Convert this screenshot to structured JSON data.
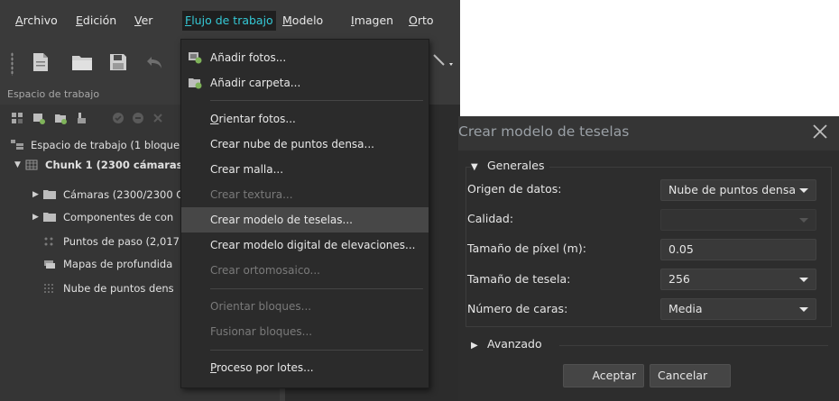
{
  "menubar": {
    "items": [
      {
        "label": "Archivo"
      },
      {
        "label": "Edición"
      },
      {
        "label": "Ver"
      },
      {
        "label": "Flujo de trabajo",
        "active": true
      },
      {
        "label": "Modelo"
      },
      {
        "label": "Imagen"
      },
      {
        "label": "Orto"
      }
    ]
  },
  "toolbar": {
    "icons": [
      "new-document-icon",
      "open-folder-icon",
      "save-icon",
      "undo-icon",
      "select-tool-icon"
    ]
  },
  "workspace": {
    "panel_title": "Espacio de trabajo",
    "toolbar_icons": [
      "add-chunk-icon",
      "add-photos-icon",
      "add-folder-icon",
      "add-marker-icon",
      "enable-icon",
      "disable-icon",
      "remove-icon"
    ],
    "tree": [
      {
        "label": "Espacio de trabajo (1 bloque,",
        "icon": "workspace-icon"
      },
      {
        "label": "Chunk 1 (2300 cámaras,",
        "icon": "chunk-icon",
        "bold": true
      },
      {
        "label": "Cámaras (2300/2300 C",
        "icon": "folder-icon"
      },
      {
        "label": "Componentes de con",
        "icon": "folder-icon"
      },
      {
        "label": "Puntos de paso (2,017",
        "icon": "tie-points-icon"
      },
      {
        "label": "Mapas de profundida",
        "icon": "depth-maps-icon"
      },
      {
        "label": "Nube de puntos dens",
        "icon": "dense-cloud-icon"
      }
    ]
  },
  "dropdown": {
    "items": [
      {
        "label": "Añadir fotos...",
        "icon": "add-photos-icon",
        "disabled": false
      },
      {
        "label": "Añadir carpeta...",
        "icon": "add-folder-icon",
        "disabled": false
      },
      {
        "label": "Orientar fotos...",
        "disabled": false
      },
      {
        "label": "Crear nube de puntos densa...",
        "disabled": false
      },
      {
        "label": "Crear malla...",
        "disabled": false
      },
      {
        "label": "Crear textura...",
        "disabled": true
      },
      {
        "label": "Crear modelo de teselas...",
        "disabled": false,
        "hover": true
      },
      {
        "label": "Crear modelo digital de elevaciones...",
        "disabled": false
      },
      {
        "label": "Crear ortomosaico...",
        "disabled": true
      },
      {
        "label": "Orientar bloques...",
        "disabled": true
      },
      {
        "label": "Fusionar bloques...",
        "disabled": true
      },
      {
        "label": "Proceso por lotes...",
        "disabled": false
      }
    ]
  },
  "dialog": {
    "title": "Crear modelo de teselas",
    "general_section": "Generales",
    "fields": [
      {
        "label": "Origen de datos:",
        "value": "Nube de puntos densa",
        "type": "select"
      },
      {
        "label": "Calidad:",
        "value": "",
        "type": "select",
        "disabled": true
      },
      {
        "label": "Tamaño de píxel (m):",
        "value": "0.05",
        "type": "input"
      },
      {
        "label": "Tamaño de tesela:",
        "value": "256",
        "type": "select"
      },
      {
        "label": "Número de caras:",
        "value": "Media",
        "type": "select"
      }
    ],
    "advanced_section": "Avanzado",
    "ok_label": "Aceptar",
    "cancel_label": "Cancelar"
  },
  "colors": {
    "accent": "#35c9d6",
    "background": "#3d3d3d",
    "dialog_background": "#2d2d2d",
    "menu_hover": "#474747"
  }
}
